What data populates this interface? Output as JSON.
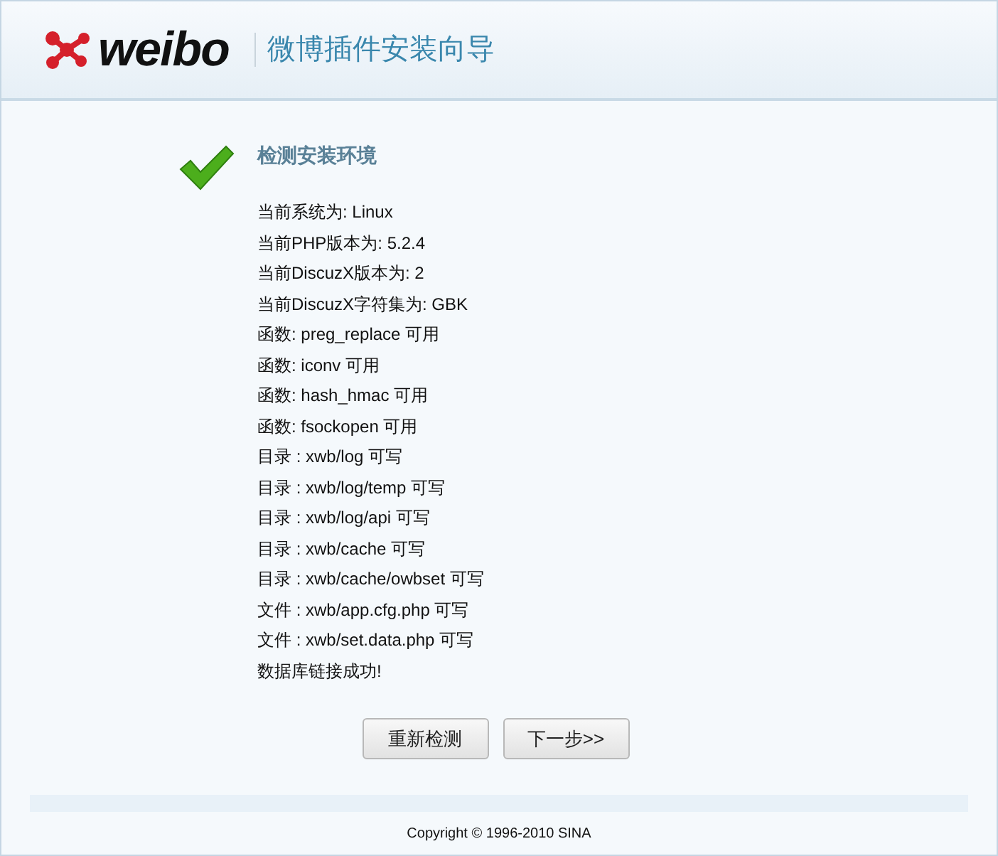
{
  "header": {
    "logo_text": "weibo",
    "title": "微博插件安装向导"
  },
  "section": {
    "title": "检测安装环境"
  },
  "checks": [
    "当前系统为: Linux",
    "当前PHP版本为: 5.2.4",
    "当前DiscuzX版本为: 2",
    "当前DiscuzX字符集为: GBK",
    "函数: preg_replace 可用",
    "函数: iconv 可用",
    "函数: hash_hmac 可用",
    "函数: fsockopen 可用",
    "目录 : xwb/log 可写",
    "目录 : xwb/log/temp 可写",
    "目录 : xwb/log/api 可写",
    "目录 : xwb/cache 可写",
    "目录 : xwb/cache/owbset 可写",
    "文件 : xwb/app.cfg.php 可写",
    "文件 : xwb/set.data.php 可写",
    "数据库链接成功!"
  ],
  "buttons": [
    "重新检测",
    "下一步>>"
  ],
  "footer": {
    "copyright": "Copyright © 1996-2010 SINA"
  }
}
